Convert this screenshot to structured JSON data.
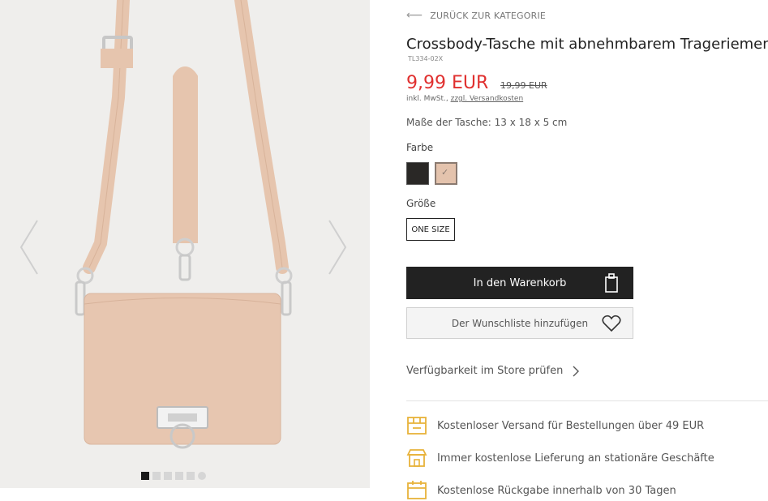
{
  "gallery": {
    "image_alt": "Crossbody-Tasche rosa",
    "prev_icon": "chevron-left-icon",
    "next_icon": "chevron-right-icon",
    "dot_count": 6,
    "active_dot": 0
  },
  "product": {
    "back_link": "ZURÜCK ZUR KATEGORIE",
    "title": "Crossbody-Tasche mit abnehmbarem Trageriemen",
    "sku": "TL334-02X",
    "price": "9,99 EUR",
    "old_price": "19,99 EUR",
    "tax_note": "inkl. MwSt., ",
    "shipping_link": "zzgl. Versandkosten",
    "dimensions": "Maße der Tasche: 13 x 18 x 5 cm",
    "color_label": "Farbe",
    "colors": [
      {
        "name": "schwarz",
        "hex": "#2a2826",
        "selected": false
      },
      {
        "name": "beige",
        "hex": "#e4c3ad",
        "selected": true
      }
    ],
    "size_label": "Größe",
    "size_value": "ONE SIZE",
    "add_to_cart": "In den Warenkorb",
    "wishlist": "Der Wunschliste hinzufügen",
    "availability": "Verfügbarkeit im Store prüfen"
  },
  "benefits": [
    {
      "icon": "shipping-box-icon",
      "text": "Kostenloser Versand für Bestellungen über 49 EUR"
    },
    {
      "icon": "store-icon",
      "text": "Immer kostenlose Lieferung an stationäre Geschäfte"
    },
    {
      "icon": "calendar-icon",
      "text": "Kostenlose Rückgabe innerhalb von 30 Tagen"
    }
  ],
  "colors": {
    "accent_red": "#e0302f",
    "dark_button": "#222222",
    "benefit_icon": "#e8b23a"
  }
}
